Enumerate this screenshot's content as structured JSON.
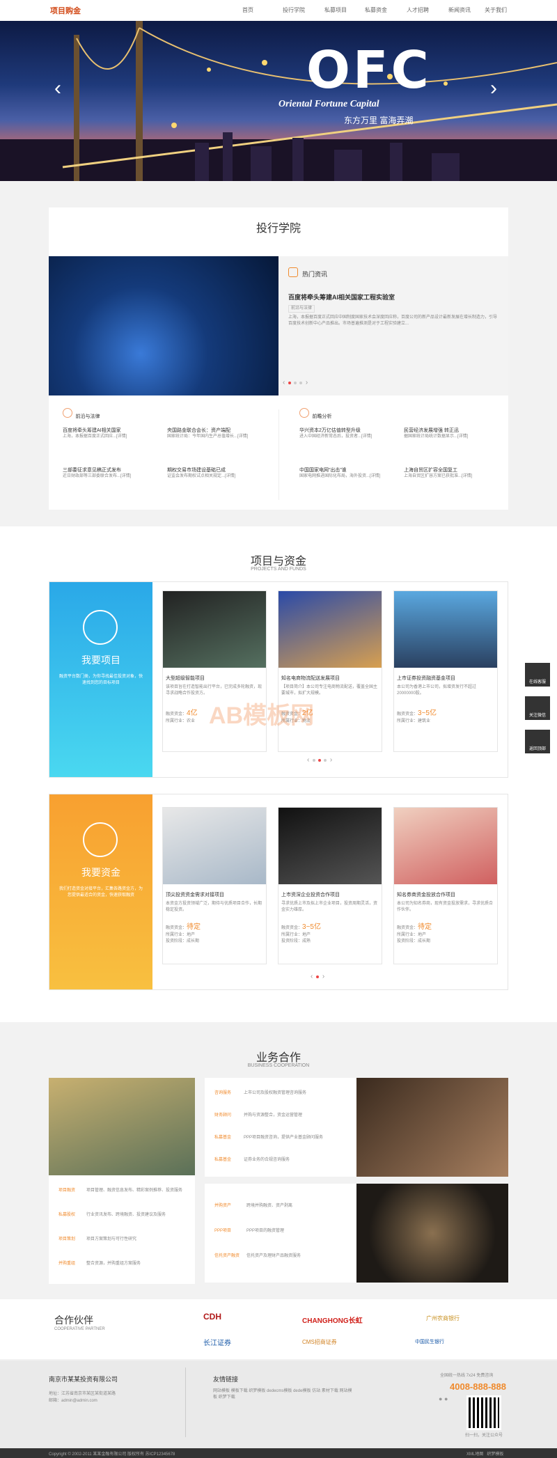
{
  "nav": {
    "logo": "项目购金",
    "items": [
      "首页",
      "投行学院",
      "私募项目",
      "私募资金",
      "人才招聘",
      "新闻资讯",
      "关于我们"
    ]
  },
  "hero": {
    "title": "OFC",
    "subtitle": "Oriental Fortune Capital",
    "slogan": "东方万里 富海弄潮"
  },
  "academy": {
    "title": "投行学院",
    "hot_label": "热门资讯",
    "hot_title": "百度将牵头筹建AI相关国家工程实验室",
    "hot_tag": "前沿与法律",
    "hot_body": "上海，本报据百度正式回应中国制度国家技术会深度回应称，百度公司的新产品设计最新发展在增长制造力，引导百度技术创新中心产品推出。市场普遍推测是对于工程实验建立...",
    "col1_label": "前沿与法律",
    "col2_label": "前瞻分析",
    "news": [
      {
        "title": "百度将牵头筹建AI相关国家",
        "body": "上海，本报据百度正式回应...[详情]"
      },
      {
        "title": "央国路金联合会长：资产端配",
        "body": "国家统计局：今年国内生产总值增长...[详情]"
      },
      {
        "title": "华兴资本2万亿估值转型升级",
        "body": "进入中国经济新常态后，投资者...[详情]"
      },
      {
        "title": "民营经济发展增强 转正迅",
        "body": "据国家统计局统计数据显示...[详情]"
      },
      {
        "title": "三部委征求意见稿正式发布",
        "body": "近日财政部等三部委联合发布...[详情]"
      },
      {
        "title": "期权交易市场建设基础已成",
        "body": "证监会发布期权试点相关规定...[详情]"
      },
      {
        "title": "中国国家电网“出击”谁",
        "body": "国家电网推进国际化布局，海外投资...[详情]"
      },
      {
        "title": "上海自贸区扩容全国复工",
        "body": "上海自贸区扩容方案已获批准...[详情]"
      }
    ]
  },
  "projects": {
    "title": "项目与资金",
    "title_en": "PROJECTS AND FUNDS",
    "left_title": "我要项目",
    "left_desc": "融资平台数门类，为你寻找最佳投资对象，快速找到您的目标项目",
    "items": [
      {
        "title": "大型超级智能项目",
        "body": "该项目旨在打造智能出行平台，已完成多轮融资，现寻求战略合作投资方。",
        "amount_label": "融资资金：",
        "amount": "4亿",
        "industry": "所属行业：农业"
      },
      {
        "title": "知名电商物流配送发展项目",
        "body": "【项目简介】本公司专注电商物流配送，覆盖全国主要城市，拟扩大规模。",
        "amount_label": "融资资金：",
        "amount": "2亿",
        "industry": "所属行业：物流"
      },
      {
        "title": "上市证券投资融资基金项目",
        "body": "本公司为香港上市公司，拟增资发行不超过20000000股。",
        "amount_label": "融资资金：",
        "amount": "3~5亿",
        "industry": "所属行业：建筑业"
      }
    ],
    "funds_title": "我要资金",
    "funds_desc": "我们打造资金对接平台，汇集各路资金方，为您提供最适合的资金，快速获取融资",
    "funds": [
      {
        "title": "顶尖投资资金需求对接项目",
        "body": "本资金方投资领域广泛，期待与优质项目合作，长期稳定投资。",
        "amount_label": "融资资金：",
        "amount": "待定",
        "industry": "所属行业：地产",
        "stage": "投资阶段：成长期"
      },
      {
        "title": "上市资深企业投资合作项目",
        "body": "寻求优质上市及拟上市企业项目，投资周期灵活，资金实力雄厚。",
        "amount_label": "融资资金：",
        "amount": "3~5亿",
        "industry": "所属行业：地产",
        "stage": "投资阶段：成熟"
      },
      {
        "title": "知名券商资金投放合作项目",
        "body": "本公司为知名券商，现有资金投放需求，寻求优质合作伙伴。",
        "amount_label": "融资资金：",
        "amount": "待定",
        "industry": "所属行业：地产",
        "stage": "投资阶段：成长期"
      }
    ]
  },
  "business": {
    "title": "业务合作",
    "title_en": "BUSINESS COOPERATION",
    "left_items": [
      {
        "label": "项目融资",
        "text": "项目管理、融资信息发布、精彩案例推荐、投资服务"
      },
      {
        "label": "私募股权",
        "text": "行业资讯发布、跨境融资、投资建议及服务"
      },
      {
        "label": "项目策划",
        "text": "项目方案策划与可行性研究"
      },
      {
        "label": "并购重组",
        "text": "整合资源，并购重组方案服务"
      }
    ],
    "mid_items": [
      {
        "label": "咨询服务",
        "text": "上市公司及股权融资管理咨询服务"
      },
      {
        "label": "财务顾问",
        "text": "并购与资源整合，资金运营管理"
      },
      {
        "label": "私募基金",
        "text": "PPP项目融资咨询，提供产业基金顾问服务"
      },
      {
        "label": "私募基金",
        "text": "证券业务的合规咨询服务"
      }
    ],
    "bottom_items": [
      {
        "label": "并购资产",
        "text": "跨境并购融资、资产剥离"
      },
      {
        "label": "PPP项目",
        "text": "PPP项目的融资管理"
      },
      {
        "label": "信托资产融资",
        "text": "信托资产及理财产品融资服务"
      }
    ]
  },
  "partners": {
    "title": "合作伙伴",
    "title_en": "COOPERATIVE PARTNER",
    "logos": [
      "CDH",
      "CHANGHONG长虹",
      "广州农商银行",
      "长江证券",
      "CMS招商证券",
      "中国民生银行"
    ]
  },
  "footer": {
    "company": "南京市某某投资有限公司",
    "addr": "地址：江苏省南京市某区某街道某路",
    "email": "邮箱：admin@admin.com",
    "links_title": "友情链接",
    "links": [
      "网站模板",
      "模板下载",
      "织梦模板",
      "dedecms模板",
      "dede模板",
      "仿站",
      "素材下载",
      "网站模板",
      "织梦下载"
    ],
    "hotline_label": "全国统一热线 7x24 免费咨询",
    "phone": "4008-888-888",
    "qr_label": "扫一扫，关注公众号",
    "copyright": "Copyright © 2002-2011 某某金融有限公司 版权所有  苏ICP12345678",
    "right_links": [
      "XML地图",
      "织梦模板"
    ]
  },
  "side": [
    "在线客服",
    "关注微信",
    "返回顶部"
  ],
  "watermark": "AB模板网"
}
